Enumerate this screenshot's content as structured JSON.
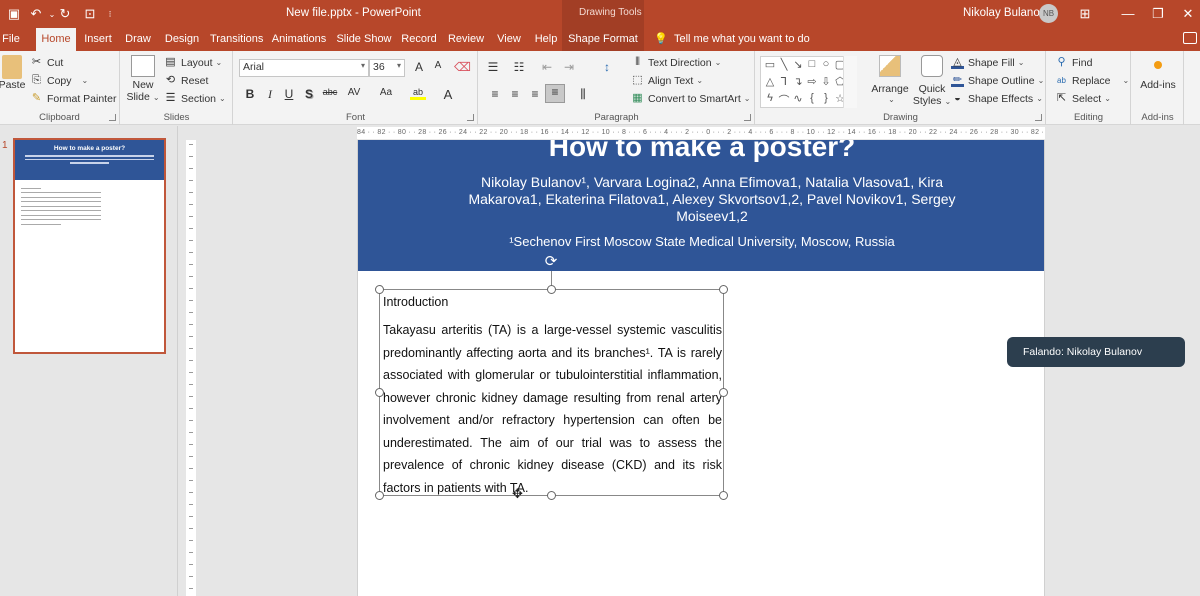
{
  "titlebar": {
    "quick_access": [
      {
        "name": "save-icon",
        "glyph": "🖫"
      },
      {
        "name": "undo-icon",
        "glyph": "↶"
      },
      {
        "name": "redo-icon",
        "glyph": "↻"
      },
      {
        "name": "present-icon",
        "glyph": "⊡"
      },
      {
        "name": "customize-icon",
        "glyph": "⁝"
      }
    ],
    "document_title": "New file.pptx  -  PowerPoint",
    "contextual_group": "Drawing Tools",
    "user_name": "Nikolay Bulanov",
    "user_initials": "NB",
    "window_controls": {
      "ribbon_display": "⊞",
      "minimize": "—",
      "restore": "❐",
      "close": "✕"
    }
  },
  "tabs": [
    {
      "label": "File",
      "active": false
    },
    {
      "label": "Home",
      "active": true
    },
    {
      "label": "Insert",
      "active": false
    },
    {
      "label": "Draw",
      "active": false
    },
    {
      "label": "Design",
      "active": false
    },
    {
      "label": "Transitions",
      "active": false
    },
    {
      "label": "Animations",
      "active": false
    },
    {
      "label": "Slide Show",
      "active": false
    },
    {
      "label": "Record",
      "active": false
    },
    {
      "label": "Review",
      "active": false
    },
    {
      "label": "View",
      "active": false
    },
    {
      "label": "Help",
      "active": false
    },
    {
      "label": "Shape Format",
      "active": false
    }
  ],
  "tell_me": "Tell me what you want to do",
  "ribbon": {
    "clipboard": {
      "label": "Clipboard",
      "paste": "Paste",
      "cut": "Cut",
      "copy": "Copy",
      "format_painter": "Format Painter"
    },
    "slides": {
      "label": "Slides",
      "new_slide": "New",
      "new_slide_2": "Slide",
      "layout": "Layout",
      "reset": "Reset",
      "section": "Section"
    },
    "font": {
      "label": "Font",
      "family": "Arial",
      "size": "36",
      "bold": "B",
      "italic": "I",
      "underline": "U",
      "shadow": "S",
      "strike": "abc",
      "spacing": "AV",
      "case": "Aa",
      "highlight": "ab",
      "color": "A",
      "grow": "A",
      "shrink": "A"
    },
    "paragraph": {
      "label": "Paragraph",
      "text_direction": "Text Direction",
      "align_text": "Align Text",
      "convert_smartart": "Convert to SmartArt"
    },
    "drawing": {
      "label": "Drawing",
      "arrange": "Arrange",
      "quick_styles_1": "Quick",
      "quick_styles_2": "Styles",
      "shape_fill": "Shape Fill",
      "shape_outline": "Shape Outline",
      "shape_effects": "Shape Effects"
    },
    "editing": {
      "label": "Editing",
      "find": "Find",
      "replace": "Replace",
      "select": "Select"
    },
    "addins": {
      "label": "Add-ins",
      "addins": "Add-ins"
    }
  },
  "thumbnails": [
    {
      "number": "1",
      "title": "How to make a poster?"
    }
  ],
  "ruler": {
    "horizontal": "84 · · 82 · · 80 · · 28 · · 26 · · 24 · · 22 · · 20 · · 18 · · 16 · · 14 · · 12 · · 10 · · 8 · · · 6 · · · 4 · · · 2 · · · 0 · · · 2 · · · 4 · · · 6 · · · 8 · · 10 · · 12 · · 14 · · 16 · · 18 · · 20 · · 22 · · 24 · · 26 · · 28 · · 30 · · 82 · · 84"
  },
  "slide": {
    "title": "How to make a poster?",
    "authors": "Nikolay Bulanov¹, Varvara Logina2, Anna Efimova1, Natalia Vlasova1, Kira Makarova1, Ekaterina Filatova1, Alexey Skvortsov1,2, Pavel Novikov1, Sergey Moiseev1,2",
    "affiliation": "¹Sechenov First Moscow State Medical University, Moscow, Russia",
    "textbox": {
      "heading": "Introduction",
      "body": "Takayasu arteritis (TA) is a large-vessel systemic vasculitis predominantly affecting aorta and its branches¹. TA is rarely associated with glomerular or tubulointerstitial inflammation, however chronic kidney damage resulting from renal artery involvement and/or refractory hypertension can often be underestimated. The aim of our trial was to assess the prevalence of chronic kidney disease (CKD) and its risk factors in patients with TA."
    }
  },
  "toast": "Falando: Nikolay Bulanov",
  "colors": {
    "accent": "#b7472a",
    "banner": "#2f5597",
    "toast": "#2c3e4e"
  }
}
